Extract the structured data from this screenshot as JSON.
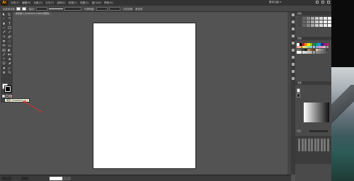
{
  "app": {
    "logo": "Ai",
    "menu": [
      "文件(F)",
      "编辑(E)",
      "对象(O)",
      "文字(T)",
      "选择(S)",
      "效果(C)",
      "视图(V)",
      "窗口(W)",
      "帮助(H)"
    ],
    "workspace": "基本功能 ▾"
  },
  "controlbar": {
    "selection": "未选择对象",
    "stroke_label": "描边:",
    "style_label": "不透明度:",
    "doc_setup": "文档设置",
    "prefs": "首选项"
  },
  "document_tab": {
    "title": "未标题-1 @ 66.67% (CMYK/预览)",
    "close": "×"
  },
  "tooltip": {
    "text": "渐变 (Gradient) (>)"
  },
  "icons": {
    "tools": [
      "selection-tool",
      "direct-selection-tool",
      "magic-wand-tool",
      "lasso-tool",
      "pen-tool",
      "type-tool",
      "line-tool",
      "rectangle-tool",
      "paintbrush-tool",
      "pencil-tool",
      "rotate-tool",
      "scale-tool",
      "width-tool",
      "free-transform-tool",
      "shape-builder-tool",
      "perspective-grid-tool",
      "mesh-tool",
      "gradient-tool",
      "eyedropper-tool",
      "blend-tool",
      "symbol-sprayer-tool",
      "column-graph-tool",
      "artboard-tool",
      "slice-tool",
      "eraser-tool",
      "scissors-tool",
      "hand-tool",
      "zoom-tool"
    ]
  },
  "panels": {
    "color_tab": "颜色",
    "swatches_tab": "色板",
    "gradient_tab": "渐变",
    "gradient_type_label": "类型:",
    "location_label": "位置:"
  },
  "colors": {
    "tooltip_bg": "#f5f5dc",
    "arrow": "#e0312a",
    "accent": "#f7a000"
  }
}
